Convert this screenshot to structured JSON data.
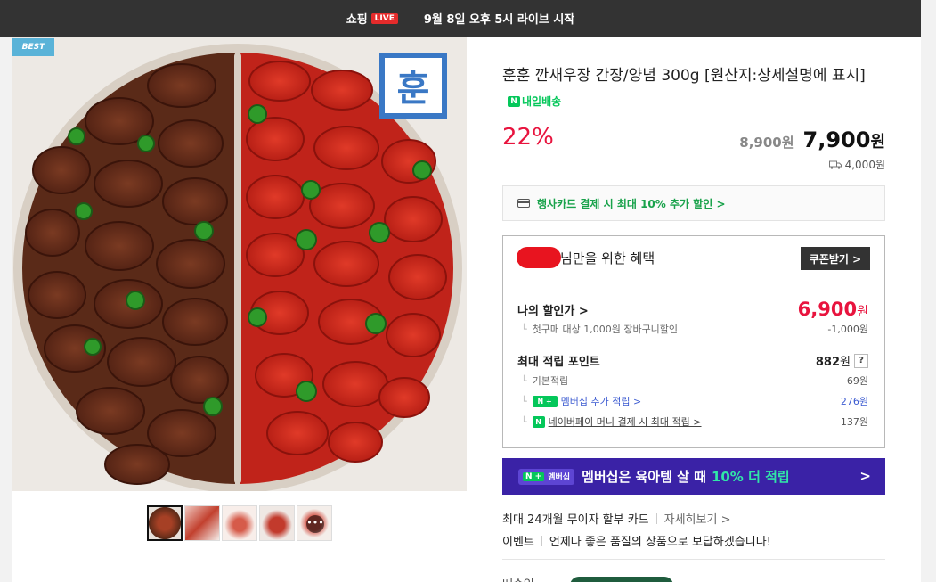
{
  "topbar": {
    "brand": "쇼핑",
    "live_badge": "LIVE",
    "notice": "9월 8일 오후 5시 라이브 시작"
  },
  "gallery": {
    "best_badge": "BEST",
    "logo_char": "훈",
    "thumb_more": "•••"
  },
  "product": {
    "title": "훈훈 깐새우장 간장/양념 300g [원산지:상세설명에 표시]",
    "delivery_badge": "내일배송",
    "discount": "22%",
    "original_price": "8,900원",
    "sale_price": "7,900",
    "sale_unit": "원",
    "shipping_fee": "4,000원"
  },
  "card_promo": {
    "text": "행사카드 결제 시 최대 10% 추가 할인 >"
  },
  "benefit": {
    "title": "님만을 위한 혜택",
    "coupon_button": "쿠폰받기 >",
    "my_price_label": "나의 할인가 >",
    "my_price_value": "6,900",
    "my_price_unit": "원",
    "first_purchase_label": "첫구매 대상 1,000원 장바구니할인",
    "first_purchase_value": "-1,000원",
    "points_label": "최대 적립 포인트",
    "points_value": "882",
    "points_unit": "원",
    "points_help": "?",
    "basic_label": "기본적립",
    "basic_value": "69원",
    "membership_label": "멤버십 추가 적립 >",
    "membership_value": "276원",
    "naverpay_label": "네이버페이 머니 결제 시 최대 적립 >",
    "naverpay_value": "137원"
  },
  "member_banner": {
    "tag": "멤버십",
    "text": "멤버십은 육아템 살 때",
    "highlight": "10% 더 적립",
    "arrow": ">"
  },
  "installment": {
    "text": "최대 24개월 무이자 할부 카드",
    "link": "자세히보기 >"
  },
  "event": {
    "label": "이벤트",
    "text": "언제나 좋은 품질의 상품으로 보답하겠습니다!"
  },
  "delivery_partial": {
    "label": "배송일"
  },
  "colors": {
    "accent_red": "#e8143e",
    "naver_green": "#04c75a",
    "member_purple": "#3a22a6"
  }
}
